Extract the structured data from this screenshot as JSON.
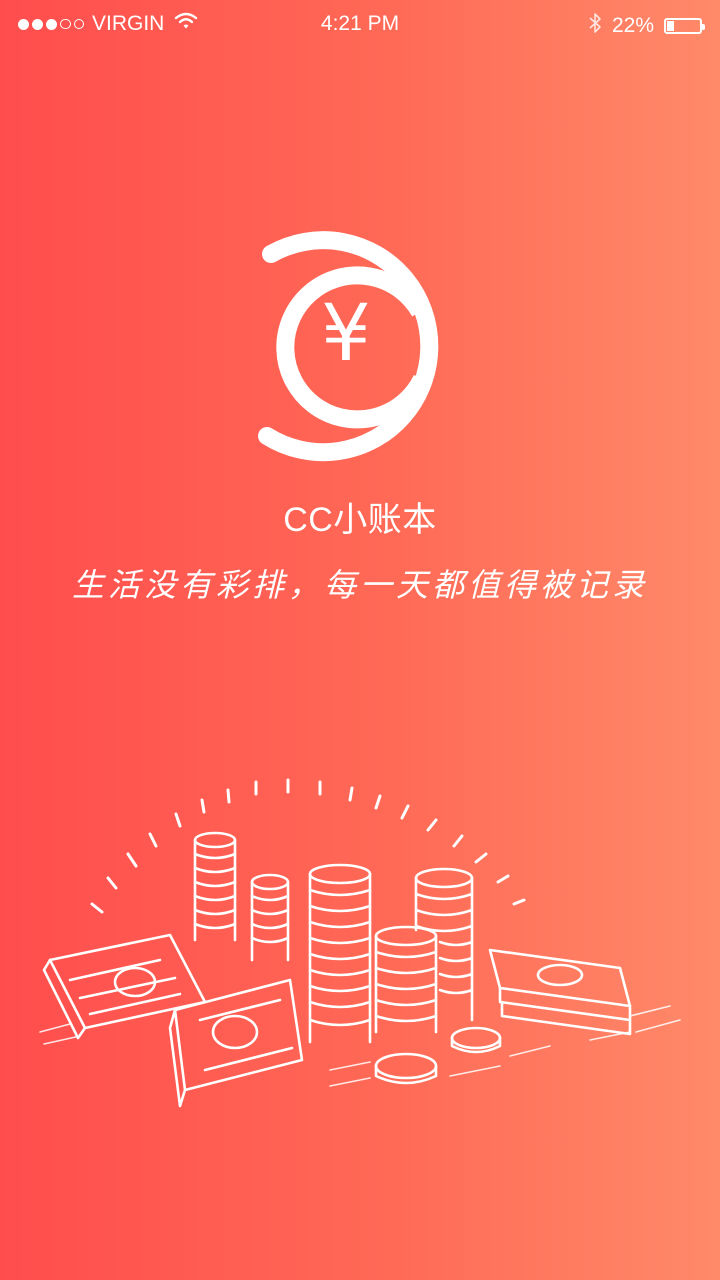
{
  "status_bar": {
    "carrier": "VIRGIN",
    "signal_strength": 3,
    "signal_max": 5,
    "time": "4:21 PM",
    "battery_percent_label": "22%",
    "battery_level": 0.22
  },
  "splash": {
    "logo_symbol": "¥",
    "app_name": "CC小账本",
    "slogan": "生活没有彩排，每一天都值得被记录"
  },
  "icons": {
    "wifi": "wifi-icon",
    "bluetooth": "bluetooth-icon",
    "battery": "battery-icon",
    "logo": "yen-coin-logo",
    "illustration": "money-pile-illustration"
  },
  "colors": {
    "gradient_start": "#ff4d4d",
    "gradient_end": "#ff8a6a",
    "foreground": "#ffffff"
  }
}
